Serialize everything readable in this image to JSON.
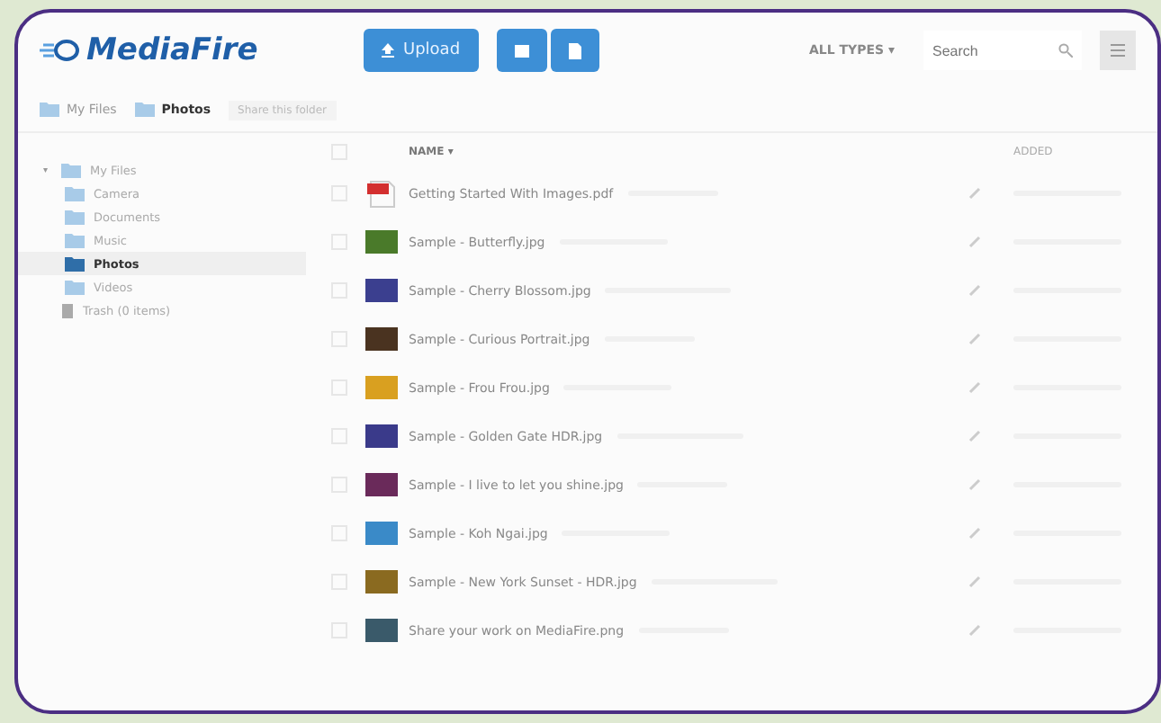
{
  "logo": "MediaFire",
  "toolbar": {
    "upload": "Upload",
    "type_filter": "ALL TYPES ▾",
    "search": {
      "placeholder": "Search"
    }
  },
  "breadcrumb": [
    {
      "label": "My Files",
      "current": false
    },
    {
      "label": "Photos",
      "current": true
    }
  ],
  "share_link": "Share this folder",
  "sidebar": {
    "items": [
      {
        "label": "My Files",
        "kind": "folder",
        "toggle": "▾",
        "selected": false,
        "expanded": true,
        "children": [
          {
            "label": "Camera",
            "kind": "folder",
            "selected": false
          },
          {
            "label": "Documents",
            "kind": "folder",
            "selected": false
          },
          {
            "label": "Music",
            "kind": "folder",
            "selected": false
          },
          {
            "label": "Photos",
            "kind": "folder",
            "selected": true
          },
          {
            "label": "Videos",
            "kind": "folder",
            "selected": false
          }
        ]
      },
      {
        "label": "Trash (0 items)",
        "kind": "trash",
        "selected": false
      }
    ]
  },
  "table": {
    "select_all_checked": false,
    "columns": [
      "NAME ▾",
      "ADDED"
    ],
    "rows": [
      {
        "name": "Getting Started With Images.pdf",
        "kind": "pdf",
        "color": "#d32f2f",
        "checked": false
      },
      {
        "name": "Sample - Butterfly.jpg",
        "kind": "image",
        "color": "#4a7a2a",
        "checked": false
      },
      {
        "name": "Sample - Cherry Blossom.jpg",
        "kind": "image",
        "color": "#3b3f8f",
        "checked": false
      },
      {
        "name": "Sample - Curious Portrait.jpg",
        "kind": "image",
        "color": "#4a3320",
        "checked": false
      },
      {
        "name": "Sample - Frou Frou.jpg",
        "kind": "image",
        "color": "#d9a020",
        "checked": false
      },
      {
        "name": "Sample - Golden Gate HDR.jpg",
        "kind": "image",
        "color": "#3a3a8a",
        "checked": false
      },
      {
        "name": "Sample - I live to let you shine.jpg",
        "kind": "image",
        "color": "#6a2a5a",
        "checked": false
      },
      {
        "name": "Sample - Koh Ngai.jpg",
        "kind": "image",
        "color": "#3a8ac8",
        "checked": false
      },
      {
        "name": "Sample - New York Sunset - HDR.jpg",
        "kind": "image",
        "color": "#8a6a20",
        "checked": false
      },
      {
        "name": "Share your work on MediaFire.png",
        "kind": "image",
        "color": "#3a5a6a",
        "checked": false
      }
    ]
  }
}
